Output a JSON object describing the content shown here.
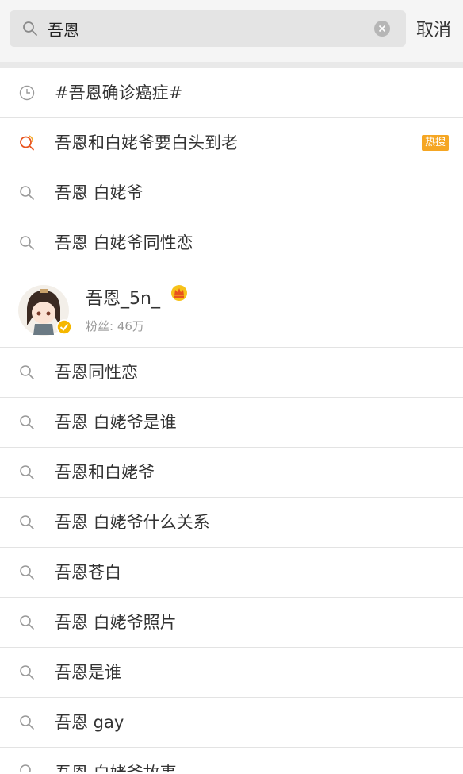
{
  "search": {
    "value": "吾恩",
    "cancel_label": "取消"
  },
  "history": {
    "label": "#吾恩确诊癌症#"
  },
  "hot": {
    "label": "吾恩和白姥爷要白头到老",
    "badge": "热搜"
  },
  "suggestions_top": [
    {
      "label": "吾恩 白姥爷"
    },
    {
      "label": "吾恩 白姥爷同性恋"
    }
  ],
  "user": {
    "name": "吾恩_5n_",
    "fans": "粉丝: 46万"
  },
  "suggestions": [
    {
      "label": "吾恩同性恋"
    },
    {
      "label": "吾恩 白姥爷是谁"
    },
    {
      "label": "吾恩和白姥爷"
    },
    {
      "label": "吾恩 白姥爷什么关系"
    },
    {
      "label": "吾恩苍白"
    },
    {
      "label": "吾恩 白姥爷照片"
    },
    {
      "label": "吾恩是谁"
    },
    {
      "label": "吾恩 gay"
    },
    {
      "label": "吾恩 白姥爷故事"
    }
  ],
  "colors": {
    "hot_badge": "#f5a623",
    "verified": "#f5b700"
  },
  "icons": {
    "search": "search-icon",
    "history": "clock-icon",
    "hot": "hot-search-icon",
    "clear": "clear-icon",
    "crown": "crown-icon",
    "verified": "verified-badge-icon"
  }
}
